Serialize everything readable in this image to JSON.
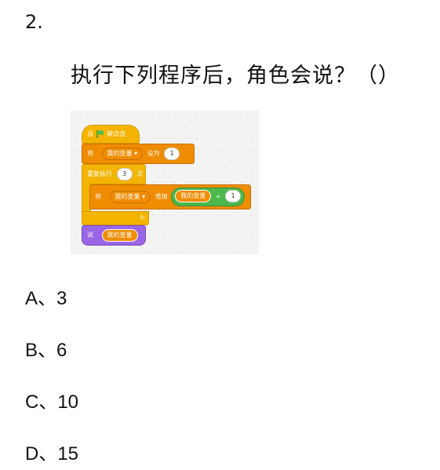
{
  "question": {
    "number": "2.",
    "text": "执行下列程序后，角色会说？（）"
  },
  "code": {
    "hat_when": "当",
    "hat_clicked": "被点击",
    "set_prefix": "将",
    "var_name": "我的变量",
    "dropdown_arrow": "▾",
    "set_to": "设为",
    "set_value": "1",
    "repeat_label": "重复执行",
    "repeat_count": "3",
    "repeat_suffix": "次",
    "change_prefix": "将",
    "change_label": "增加",
    "plus": "+",
    "add_value": "1",
    "loop_arrow": "↻",
    "say_label": "说",
    "colors": {
      "events": "#f5b400",
      "variables": "#f08c00",
      "looks": "#9a66e5",
      "operators": "#4cb84c"
    }
  },
  "choices": [
    {
      "label": "A、3"
    },
    {
      "label": "B、6"
    },
    {
      "label": "C、10"
    },
    {
      "label": "D、15"
    }
  ]
}
